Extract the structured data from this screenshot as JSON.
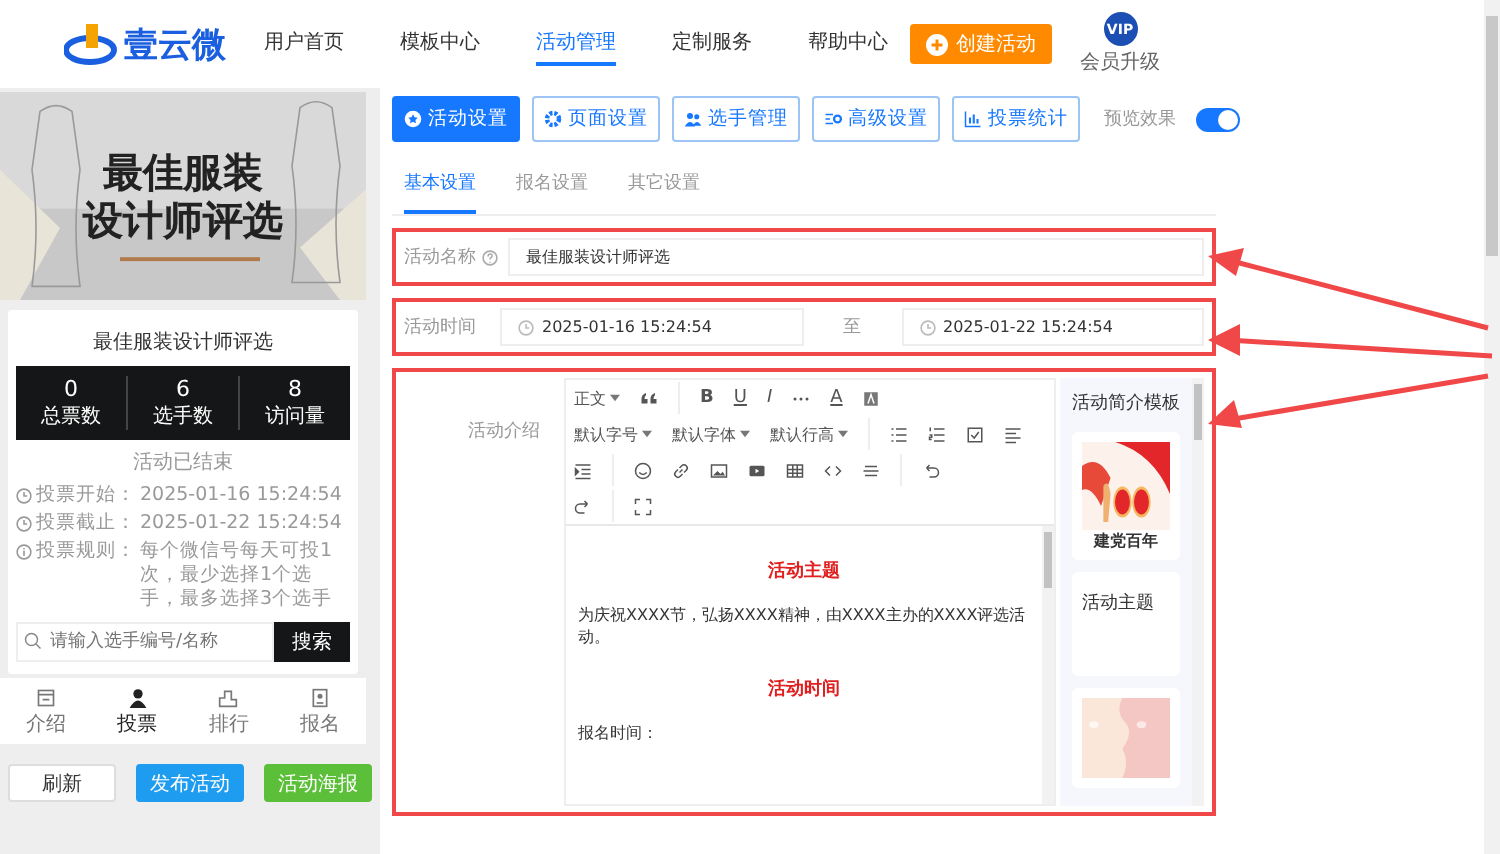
{
  "brand": {
    "name": "壹云微"
  },
  "nav": [
    {
      "label": "用户首页",
      "selected": false
    },
    {
      "label": "模板中心",
      "selected": false
    },
    {
      "label": "活动管理",
      "selected": true
    },
    {
      "label": "定制服务",
      "selected": false
    },
    {
      "label": "帮助中心",
      "selected": false
    }
  ],
  "create_button": "创建活动",
  "vip": {
    "badge": "VIP",
    "label": "会员升级"
  },
  "preview": {
    "banner_lines": [
      "最佳服装",
      "设计师评选"
    ],
    "title": "最佳服装设计师评选",
    "stats": [
      {
        "value": "0",
        "label": "总票数"
      },
      {
        "value": "6",
        "label": "选手数"
      },
      {
        "value": "8",
        "label": "访问量"
      }
    ],
    "status": "活动已结束",
    "info": [
      {
        "kind": "time",
        "label": "投票开始：",
        "value": "2025-01-16 15:24:54"
      },
      {
        "kind": "time",
        "label": "投票截止：",
        "value": "2025-01-22 15:24:54"
      },
      {
        "kind": "info",
        "label": "投票规则：",
        "value": "每个微信号每天可投1次，最少选择1个选手，最多选择3个选手"
      }
    ],
    "search": {
      "placeholder": "请输入选手编号/名称",
      "button": "搜索"
    },
    "tabbar": [
      {
        "label": "介绍",
        "selected": false
      },
      {
        "label": "投票",
        "selected": true
      },
      {
        "label": "排行",
        "selected": false
      },
      {
        "label": "报名",
        "selected": false
      }
    ],
    "actions": [
      {
        "label": "刷新",
        "kind": "default"
      },
      {
        "label": "发布活动",
        "kind": "primary"
      },
      {
        "label": "活动海报",
        "kind": "success"
      }
    ]
  },
  "tabs": [
    {
      "label": "活动设置",
      "selected": true
    },
    {
      "label": "页面设置",
      "selected": false
    },
    {
      "label": "选手管理",
      "selected": false
    },
    {
      "label": "高级设置",
      "selected": false
    },
    {
      "label": "投票统计",
      "selected": false
    }
  ],
  "preview_toggle": {
    "label": "预览效果",
    "on": true
  },
  "subtabs": [
    {
      "label": "基本设置",
      "selected": true
    },
    {
      "label": "报名设置",
      "selected": false
    },
    {
      "label": "其它设置",
      "selected": false
    }
  ],
  "form": {
    "name": {
      "label": "活动名称",
      "value": "最佳服装设计师评选"
    },
    "time": {
      "label": "活动时间",
      "start": "2025-01-16 15:24:54",
      "separator": "至",
      "end": "2025-01-22 15:24:54"
    },
    "intro": {
      "label": "活动介绍",
      "toolbar_texts": [
        "正文",
        "B",
        "U",
        "I",
        "A",
        "默认字号",
        "默认字体",
        "默认行高"
      ],
      "content": [
        {
          "kind": "heading",
          "text": "活动主题"
        },
        {
          "kind": "paragraph",
          "text": "为庆祝XXXX节，弘扬XXXX精神，由XXXX主办的XXXX评选活动。"
        },
        {
          "kind": "heading",
          "text": "活动时间"
        },
        {
          "kind": "paragraph",
          "text": "报名时间："
        }
      ],
      "templates": {
        "title": "活动简介模板",
        "items": [
          {
            "kind": "picture",
            "caption": "建党百年"
          },
          {
            "kind": "text",
            "caption": "活动主题"
          },
          {
            "kind": "picture"
          }
        ]
      }
    }
  }
}
